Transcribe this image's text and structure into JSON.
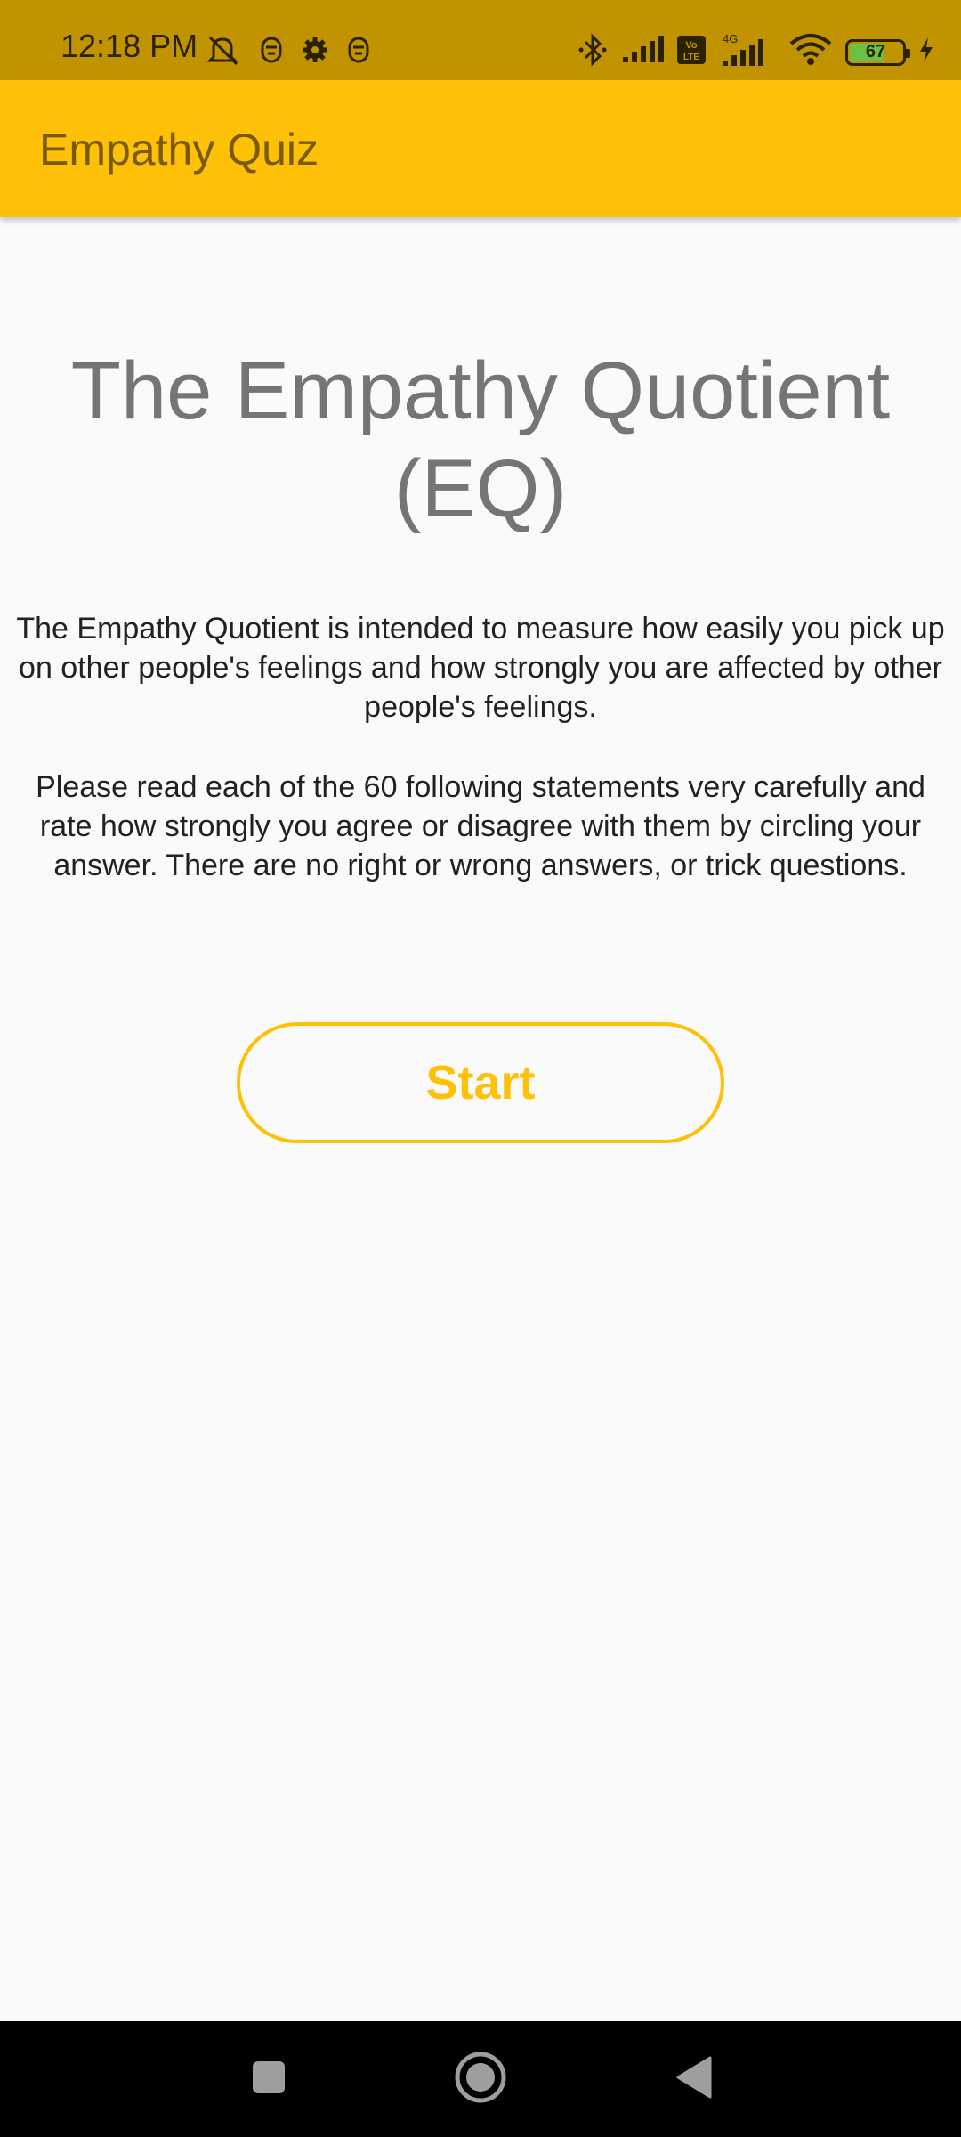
{
  "status_bar": {
    "time": "12:18 PM",
    "battery_level": "67",
    "battery_fraction": 0.67,
    "icons_left": [
      "mute-icon",
      "notification-icon",
      "settings-icon",
      "notification-icon"
    ],
    "icons_right": [
      "bluetooth-icon",
      "signal-icon",
      "volte-icon",
      "signal-4g-icon",
      "wifi-icon",
      "battery-icon",
      "charging-icon"
    ],
    "network_label": "4G",
    "volte_label": "Vo LTE"
  },
  "app_bar": {
    "title": "Empathy Quiz",
    "color": "#ffc107"
  },
  "main": {
    "heading": "The Empathy Quotient (EQ)",
    "description": "The Empathy Quotient is intended to measure how easily you pick up on other people's feelings and how strongly you are affected by other people's feelings.",
    "instructions": "Please read each of the 60 following statements very carefully and rate how strongly you agree or disagree with them by circling your answer. There are no right or wrong answers, or trick questions.",
    "start_label": "Start"
  },
  "nav_bar": {
    "buttons": [
      "recents-icon",
      "home-icon",
      "back-icon"
    ]
  }
}
